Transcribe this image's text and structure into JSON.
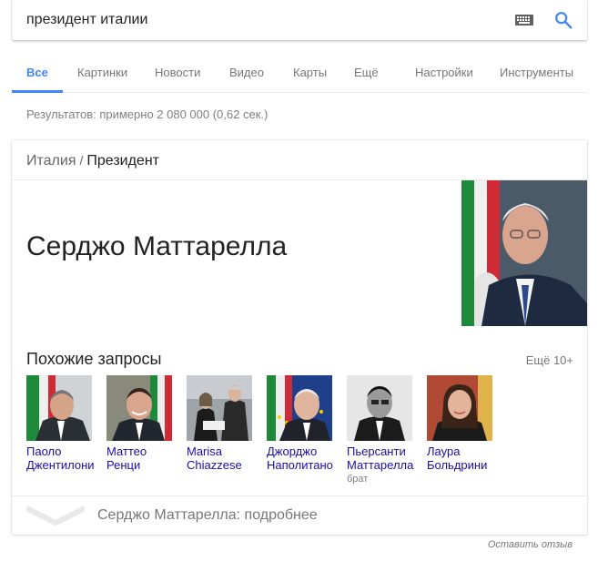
{
  "search": {
    "query": "президент италии",
    "keyboard_icon": "keyboard-icon",
    "search_icon": "search-icon"
  },
  "tabs": [
    {
      "label": "Все",
      "active": true
    },
    {
      "label": "Картинки"
    },
    {
      "label": "Новости"
    },
    {
      "label": "Видео"
    },
    {
      "label": "Карты"
    },
    {
      "label": "Ещё"
    },
    {
      "label": "Настройки"
    },
    {
      "label": "Инструменты"
    }
  ],
  "results_stats": "Результатов: примерно 2 080 000 (0,62 сек.)",
  "card": {
    "breadcrumb": {
      "parent": "Италия",
      "separator": "/",
      "current": "Президент"
    },
    "title": "Серджо Маттарелла",
    "related_heading": "Похожие запросы",
    "more_link": "Ещё 10+",
    "related": [
      {
        "name": "Паоло Джентилони",
        "sub": ""
      },
      {
        "name": "Маттео Ренци",
        "sub": ""
      },
      {
        "name": "Marisa Chiazzese",
        "sub": ""
      },
      {
        "name": "Джорджо Наполитано",
        "sub": ""
      },
      {
        "name": "Пьерсанти Маттарелла",
        "sub": "брат"
      },
      {
        "name": "Лаура Больдрини",
        "sub": ""
      }
    ],
    "more_about": "Серджо Маттарелла: подробнее"
  },
  "feedback": "Оставить отзыв",
  "colors": {
    "accent": "#4285f4",
    "link": "#1a0dab",
    "muted": "#777777"
  }
}
